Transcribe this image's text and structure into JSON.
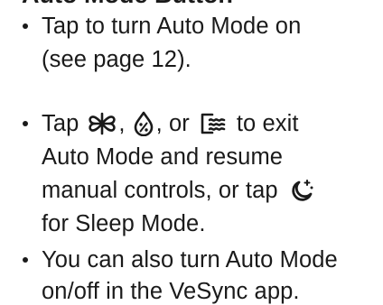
{
  "heading": "Auto Mode Button",
  "bullets": [
    {
      "lines": [
        [
          "Tap to turn Auto Mode on"
        ],
        [
          "(see page 12)."
        ]
      ]
    },
    {
      "l1_a": "Tap",
      "l1_b": ",",
      "l1_c": ", or",
      "l1_d": "to exit",
      "l2": "Auto Mode and resume",
      "l3_a": "manual controls, or tap",
      "l4": "for Sleep Mode.",
      "icons": [
        "fan-icon",
        "humidity-icon",
        "mist-level-icon",
        "sleep-mode-icon"
      ]
    },
    {
      "lines": [
        [
          "You can also turn Auto Mode"
        ],
        [
          "on/off in the VeSync app."
        ]
      ]
    }
  ]
}
